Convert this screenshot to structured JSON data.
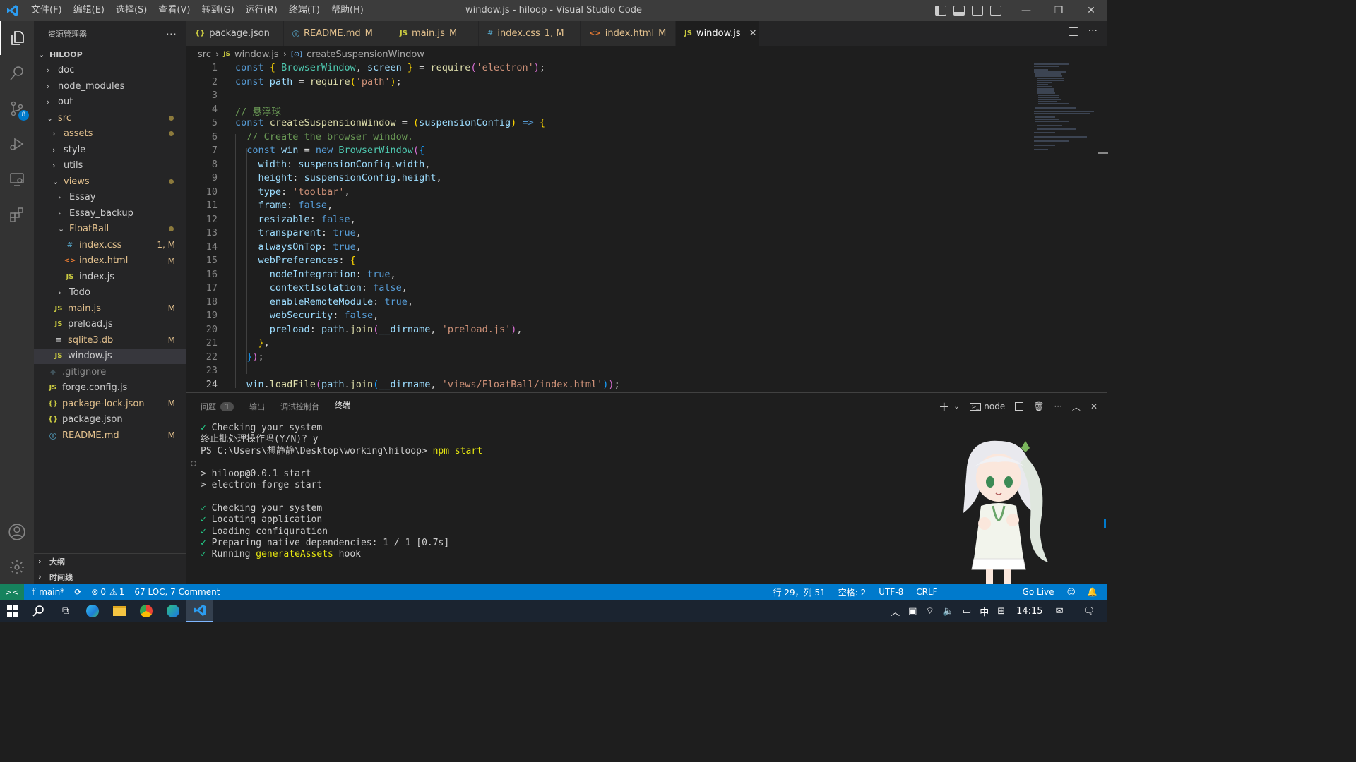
{
  "window": {
    "title": "window.js - hiloop - Visual Studio Code"
  },
  "menu": [
    "文件(F)",
    "编辑(E)",
    "选择(S)",
    "查看(V)",
    "转到(G)",
    "运行(R)",
    "终端(T)",
    "帮助(H)"
  ],
  "activity": {
    "source_control_badge": "8"
  },
  "explorer": {
    "title": "资源管理器",
    "root": "HILOOP",
    "items": [
      {
        "label": "doc",
        "kind": "folder",
        "open": false,
        "depth": 0
      },
      {
        "label": "node_modules",
        "kind": "folder",
        "open": false,
        "depth": 0
      },
      {
        "label": "out",
        "kind": "folder",
        "open": false,
        "depth": 0
      },
      {
        "label": "src",
        "kind": "folder",
        "open": true,
        "depth": 0,
        "mod": "dot"
      },
      {
        "label": "assets",
        "kind": "folder",
        "open": false,
        "depth": 1,
        "mod": "dot"
      },
      {
        "label": "style",
        "kind": "folder",
        "open": false,
        "depth": 1
      },
      {
        "label": "utils",
        "kind": "folder",
        "open": false,
        "depth": 1
      },
      {
        "label": "views",
        "kind": "folder",
        "open": true,
        "depth": 1,
        "mod": "dot"
      },
      {
        "label": "Essay",
        "kind": "folder",
        "open": false,
        "depth": 2
      },
      {
        "label": "Essay_backup",
        "kind": "folder",
        "open": false,
        "depth": 2
      },
      {
        "label": "FloatBall",
        "kind": "folder",
        "open": true,
        "depth": 2,
        "mod": "dot"
      },
      {
        "label": "index.css",
        "kind": "css",
        "depth": 3,
        "status": "1, M"
      },
      {
        "label": "index.html",
        "kind": "html",
        "depth": 3,
        "status": "M"
      },
      {
        "label": "index.js",
        "kind": "js",
        "depth": 3
      },
      {
        "label": "Todo",
        "kind": "folder",
        "open": false,
        "depth": 2
      },
      {
        "label": "main.js",
        "kind": "js",
        "depth": 1,
        "status": "M"
      },
      {
        "label": "preload.js",
        "kind": "js",
        "depth": 1
      },
      {
        "label": "sqlite3.db",
        "kind": "db",
        "depth": 1,
        "status": "M"
      },
      {
        "label": "window.js",
        "kind": "js",
        "depth": 1,
        "selected": true
      },
      {
        "label": ".gitignore",
        "kind": "git",
        "depth": 0
      },
      {
        "label": "forge.config.js",
        "kind": "js",
        "depth": 0
      },
      {
        "label": "package-lock.json",
        "kind": "json",
        "depth": 0,
        "status": "M"
      },
      {
        "label": "package.json",
        "kind": "json",
        "depth": 0
      },
      {
        "label": "README.md",
        "kind": "info",
        "depth": 0,
        "status": "M"
      }
    ],
    "outline": "大纲",
    "timeline": "时间线"
  },
  "tabs": [
    {
      "icon": "{}",
      "label": "package.json",
      "status": ""
    },
    {
      "icon": "ⓘ",
      "label": "README.md",
      "status": "M"
    },
    {
      "icon": "JS",
      "label": "main.js",
      "status": "M"
    },
    {
      "icon": "#",
      "label": "index.css",
      "status": "1, M"
    },
    {
      "icon": "<>",
      "label": "index.html",
      "status": "M"
    },
    {
      "icon": "JS",
      "label": "window.js",
      "status": "",
      "active": true
    }
  ],
  "breadcrumb": [
    "src",
    "window.js",
    "createSuspensionWindow"
  ],
  "code": [
    [
      [
        "kw",
        "const"
      ],
      [
        "pl",
        " "
      ],
      [
        "br1",
        "{"
      ],
      [
        "pl",
        " "
      ],
      [
        "cls",
        "BrowserWindow"
      ],
      [
        "pl",
        ", "
      ],
      [
        "var",
        "screen"
      ],
      [
        "pl",
        " "
      ],
      [
        "br1",
        "}"
      ],
      [
        "pl",
        " = "
      ],
      [
        "fn",
        "require"
      ],
      [
        "br2",
        "("
      ],
      [
        "str",
        "'electron'"
      ],
      [
        "br2",
        ")"
      ],
      [
        "pl",
        ";"
      ]
    ],
    [
      [
        "kw",
        "const"
      ],
      [
        "pl",
        " "
      ],
      [
        "var",
        "path"
      ],
      [
        "pl",
        " = "
      ],
      [
        "fn",
        "require"
      ],
      [
        "br1",
        "("
      ],
      [
        "str",
        "'path'"
      ],
      [
        "br1",
        ")"
      ],
      [
        "pl",
        ";"
      ]
    ],
    [],
    [
      [
        "cm",
        "// 悬浮球"
      ]
    ],
    [
      [
        "kw",
        "const"
      ],
      [
        "pl",
        " "
      ],
      [
        "fn",
        "createSuspensionWindow"
      ],
      [
        "pl",
        " = "
      ],
      [
        "br1",
        "("
      ],
      [
        "var",
        "suspensionConfig"
      ],
      [
        "br1",
        ")"
      ],
      [
        "pl",
        " "
      ],
      [
        "kw",
        "=>"
      ],
      [
        "pl",
        " "
      ],
      [
        "br1",
        "{"
      ]
    ],
    [
      [
        "pl",
        "  "
      ],
      [
        "cm",
        "// Create the browser window."
      ]
    ],
    [
      [
        "pl",
        "  "
      ],
      [
        "kw",
        "const"
      ],
      [
        "pl",
        " "
      ],
      [
        "var",
        "win"
      ],
      [
        "pl",
        " = "
      ],
      [
        "kw",
        "new"
      ],
      [
        "pl",
        " "
      ],
      [
        "cls",
        "BrowserWindow"
      ],
      [
        "br2",
        "("
      ],
      [
        "br3",
        "{"
      ]
    ],
    [
      [
        "pl",
        "    "
      ],
      [
        "var",
        "width"
      ],
      [
        "pl",
        ": "
      ],
      [
        "var",
        "suspensionConfig"
      ],
      [
        "pl",
        "."
      ],
      [
        "var",
        "width"
      ],
      [
        "pl",
        ","
      ]
    ],
    [
      [
        "pl",
        "    "
      ],
      [
        "var",
        "height"
      ],
      [
        "pl",
        ": "
      ],
      [
        "var",
        "suspensionConfig"
      ],
      [
        "pl",
        "."
      ],
      [
        "var",
        "height"
      ],
      [
        "pl",
        ","
      ]
    ],
    [
      [
        "pl",
        "    "
      ],
      [
        "var",
        "type"
      ],
      [
        "pl",
        ": "
      ],
      [
        "str",
        "'toolbar'"
      ],
      [
        "pl",
        ","
      ]
    ],
    [
      [
        "pl",
        "    "
      ],
      [
        "var",
        "frame"
      ],
      [
        "pl",
        ": "
      ],
      [
        "kw",
        "false"
      ],
      [
        "pl",
        ","
      ]
    ],
    [
      [
        "pl",
        "    "
      ],
      [
        "var",
        "resizable"
      ],
      [
        "pl",
        ": "
      ],
      [
        "kw",
        "false"
      ],
      [
        "pl",
        ","
      ]
    ],
    [
      [
        "pl",
        "    "
      ],
      [
        "var",
        "transparent"
      ],
      [
        "pl",
        ": "
      ],
      [
        "kw",
        "true"
      ],
      [
        "pl",
        ","
      ]
    ],
    [
      [
        "pl",
        "    "
      ],
      [
        "var",
        "alwaysOnTop"
      ],
      [
        "pl",
        ": "
      ],
      [
        "kw",
        "true"
      ],
      [
        "pl",
        ","
      ]
    ],
    [
      [
        "pl",
        "    "
      ],
      [
        "var",
        "webPreferences"
      ],
      [
        "pl",
        ": "
      ],
      [
        "br1",
        "{"
      ]
    ],
    [
      [
        "pl",
        "      "
      ],
      [
        "var",
        "nodeIntegration"
      ],
      [
        "pl",
        ": "
      ],
      [
        "kw",
        "true"
      ],
      [
        "pl",
        ","
      ]
    ],
    [
      [
        "pl",
        "      "
      ],
      [
        "var",
        "contextIsolation"
      ],
      [
        "pl",
        ": "
      ],
      [
        "kw",
        "false"
      ],
      [
        "pl",
        ","
      ]
    ],
    [
      [
        "pl",
        "      "
      ],
      [
        "var",
        "enableRemoteModule"
      ],
      [
        "pl",
        ": "
      ],
      [
        "kw",
        "true"
      ],
      [
        "pl",
        ","
      ]
    ],
    [
      [
        "pl",
        "      "
      ],
      [
        "var",
        "webSecurity"
      ],
      [
        "pl",
        ": "
      ],
      [
        "kw",
        "false"
      ],
      [
        "pl",
        ","
      ]
    ],
    [
      [
        "pl",
        "      "
      ],
      [
        "var",
        "preload"
      ],
      [
        "pl",
        ": "
      ],
      [
        "var",
        "path"
      ],
      [
        "pl",
        "."
      ],
      [
        "fn",
        "join"
      ],
      [
        "br2",
        "("
      ],
      [
        "var",
        "__dirname"
      ],
      [
        "pl",
        ", "
      ],
      [
        "str",
        "'preload.js'"
      ],
      [
        "br2",
        ")"
      ],
      [
        "pl",
        ","
      ]
    ],
    [
      [
        "pl",
        "    "
      ],
      [
        "br1",
        "}"
      ],
      [
        "pl",
        ","
      ]
    ],
    [
      [
        "pl",
        "  "
      ],
      [
        "br3",
        "}"
      ],
      [
        "br2",
        ")"
      ],
      [
        "pl",
        ";"
      ]
    ],
    [],
    [
      [
        "pl",
        "  "
      ],
      [
        "var",
        "win"
      ],
      [
        "pl",
        "."
      ],
      [
        "fn",
        "loadFile"
      ],
      [
        "br2",
        "("
      ],
      [
        "var",
        "path"
      ],
      [
        "pl",
        "."
      ],
      [
        "fn",
        "join"
      ],
      [
        "br3",
        "("
      ],
      [
        "var",
        "__dirname"
      ],
      [
        "pl",
        ", "
      ],
      [
        "str",
        "'views/FloatBall/index.html'"
      ],
      [
        "br3",
        ")"
      ],
      [
        "br2",
        ")"
      ],
      [
        "pl",
        ";"
      ]
    ]
  ],
  "panel": {
    "tabs": [
      {
        "label": "问题",
        "badge": "1"
      },
      {
        "label": "输出"
      },
      {
        "label": "调试控制台"
      },
      {
        "label": "终端",
        "active": true
      }
    ],
    "shell": "node",
    "terminal": [
      "✓ Checking your system",
      "终止批处理操作吗(Y/N)? y",
      "PS C:\\Users\\想静静\\Desktop\\working\\hiloop> npm start",
      "",
      "> hiloop@0.0.1 start",
      "> electron-forge start",
      "",
      "✓ Checking your system",
      "✓ Locating application",
      "✓ Loading configuration",
      "✓ Preparing native dependencies: 1 / 1 [0.7s]",
      "✓ Running generateAssets hook"
    ]
  },
  "status": {
    "branch": "main*",
    "errors": "0",
    "warnings": "1",
    "loc": "67 LOC, 7 Comment",
    "position": "行 29，列 51",
    "spaces": "空格: 2",
    "encoding": "UTF-8",
    "eol": "CRLF",
    "golive": "Go Live"
  },
  "taskbar": {
    "time": "14:15",
    "ime": "中"
  }
}
